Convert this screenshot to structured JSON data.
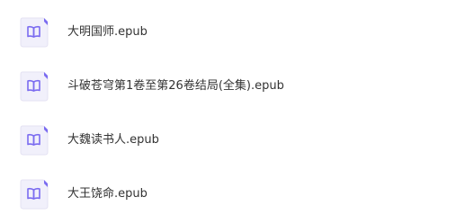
{
  "files": [
    {
      "name": "大明国师.epub",
      "icon": "epub-book-icon"
    },
    {
      "name": "斗破苍穹第1卷至第26卷结局(全集).epub",
      "icon": "epub-book-icon"
    },
    {
      "name": "大魏读书人.epub",
      "icon": "epub-book-icon"
    },
    {
      "name": "大王饶命.epub",
      "icon": "epub-book-icon"
    }
  ],
  "colors": {
    "icon_accent": "#7b6cf0",
    "icon_background": "#f1f0fb",
    "text": "#333333"
  }
}
